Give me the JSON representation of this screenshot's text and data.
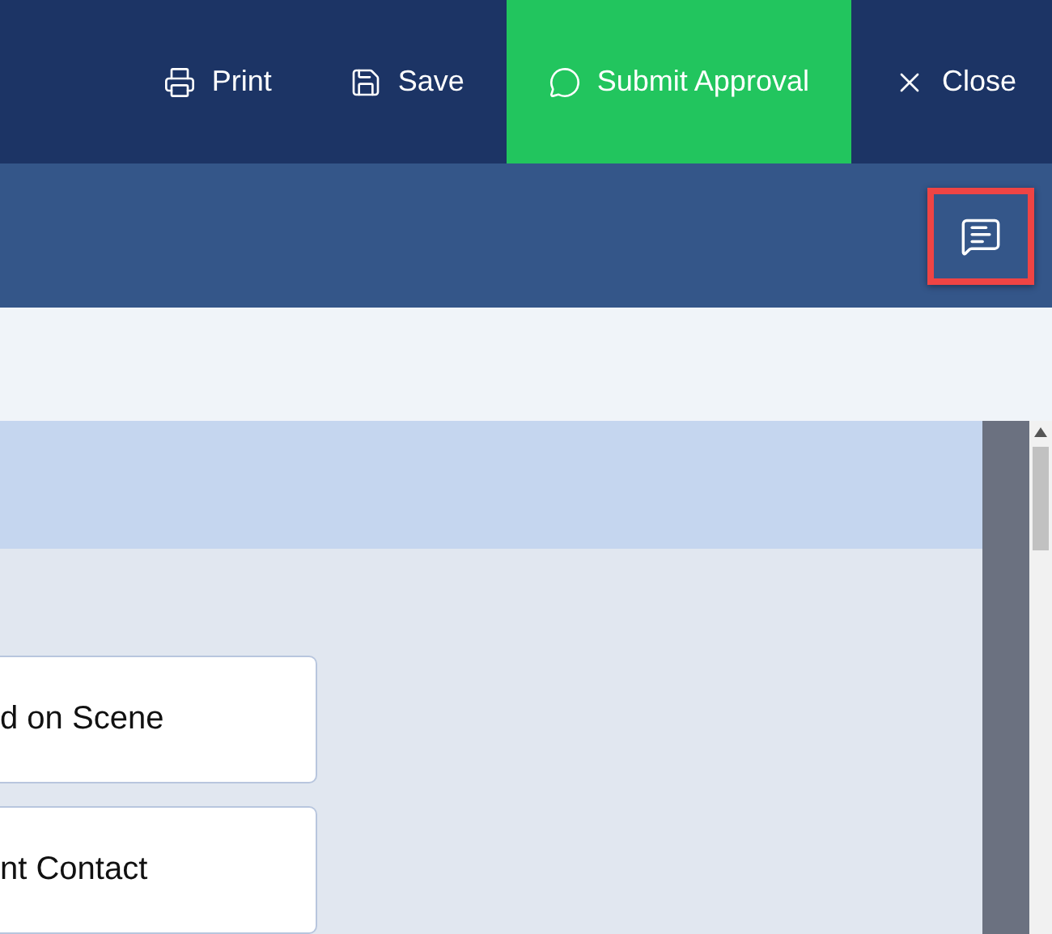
{
  "toolbar": {
    "actions": [
      {
        "label": "Print",
        "kind": "print",
        "primary": false
      },
      {
        "label": "Save",
        "kind": "save",
        "primary": false
      },
      {
        "label": "Submit Approval",
        "kind": "comment",
        "primary": true
      },
      {
        "label": "Close",
        "kind": "close",
        "primary": false
      }
    ]
  },
  "subheader": {
    "comment_button": {
      "highlighted": true
    }
  },
  "cards": [
    {
      "label": "d on Scene"
    },
    {
      "label": "nt Contact"
    }
  ]
}
